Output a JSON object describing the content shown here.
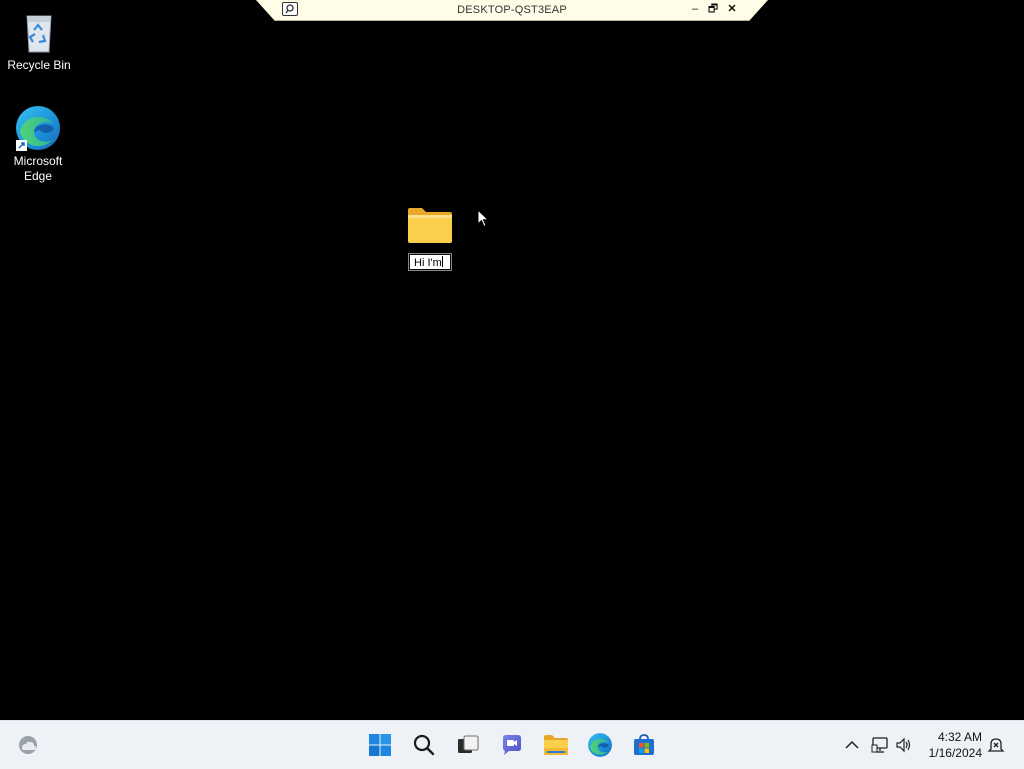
{
  "remote_bar": {
    "title": "DESKTOP-QST3EAP",
    "minimize": "–",
    "restore": "🗗",
    "close": "✕"
  },
  "desktop": {
    "icons": [
      {
        "label": "Recycle Bin",
        "icon": "recycle-bin-icon"
      },
      {
        "label": "Microsoft Edge",
        "icon": "edge-icon"
      }
    ],
    "folder": {
      "icon": "folder-icon",
      "rename_value": "Hi I'm"
    }
  },
  "taskbar": {
    "widgets": "weather-icon",
    "apps": [
      "start-icon",
      "search-icon",
      "task-view-icon",
      "chat-icon",
      "file-explorer-icon",
      "edge-icon",
      "store-icon"
    ],
    "tray": [
      "chevron-up-icon",
      "network-icon",
      "volume-icon",
      "notification-icon"
    ],
    "time": "4:32 AM",
    "date": "1/16/2024"
  },
  "colors": {
    "desktop_bg": "#000000",
    "taskbar_bg": "#eef1f6",
    "remote_bar_bg": "#fffde7",
    "folder_yellow": "#f9cf4c"
  }
}
